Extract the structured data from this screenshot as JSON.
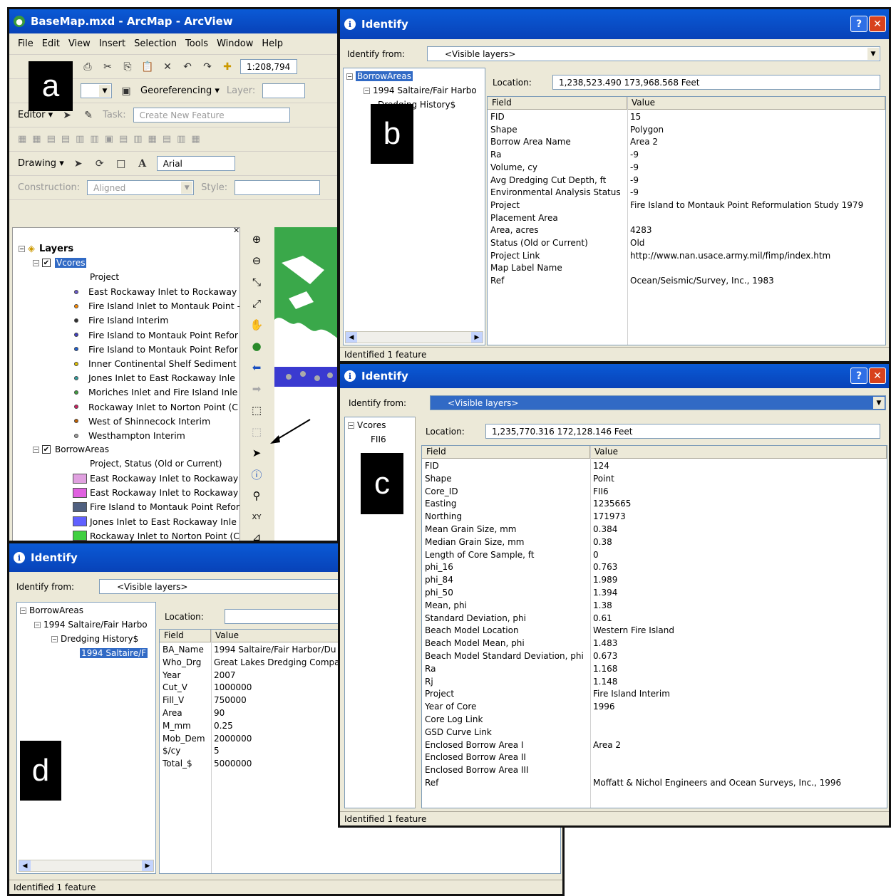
{
  "panel_tags": {
    "a": "a",
    "b": "b",
    "c": "c",
    "d": "d"
  },
  "arcmap": {
    "title": "BaseMap.mxd - ArcMap - ArcView",
    "menu": [
      "File",
      "Edit",
      "View",
      "Insert",
      "Selection",
      "Tools",
      "Window",
      "Help"
    ],
    "scale": "1:208,794",
    "georef_label": "Georeferencing ▾",
    "layer_label": "Layer:",
    "editor_label": "Editor ▾",
    "task_label": "Task:",
    "task_value": "Create New Feature",
    "drawing_label": "Drawing ▾",
    "font_value": "Arial",
    "construction_label": "Construction:",
    "construction_value": "Aligned",
    "style_label": "Style:",
    "toc": {
      "root": "Layers",
      "vcores_label": "Vcores",
      "vcores_field": "Project",
      "vcores_items": [
        {
          "label": "East Rockaway Inlet to Rockaway",
          "color": "#6a5acd"
        },
        {
          "label": "Fire Island Inlet to Montauk Point -",
          "color": "#ff8c00"
        },
        {
          "label": "Fire Island Interim",
          "color": "#303030"
        },
        {
          "label": "Fire Island to Montauk Point Refor",
          "color": "#4040c0"
        },
        {
          "label": "Fire Island to Montauk Point Refor",
          "color": "#2060d0"
        },
        {
          "label": "Inner Continental Shelf Sediment a",
          "color": "#e0c000"
        },
        {
          "label": "Jones Inlet to East Rockaway Inle",
          "color": "#30a0a0"
        },
        {
          "label": "Moriches Inlet and Fire Island Inle",
          "color": "#40a040"
        },
        {
          "label": "Rockaway Inlet to Norton Point (C",
          "color": "#d02060"
        },
        {
          "label": "West of Shinnecock Interim",
          "color": "#c06000"
        },
        {
          "label": "Westhampton Interim",
          "color": "#a0a0a0"
        }
      ],
      "borrow_label": "BorrowAreas",
      "borrow_field": "Project, Status (Old or Current)",
      "borrow_items": [
        {
          "label": "East Rockaway Inlet to Rockaway",
          "color": "#e0a0e0"
        },
        {
          "label": "East Rockaway Inlet to Rockaway",
          "color": "#e060e0"
        },
        {
          "label": "Fire Island to Montauk Point Refor",
          "color": "#506080"
        },
        {
          "label": "Jones Inlet to East Rockaway Inle",
          "color": "#6060ff"
        },
        {
          "label": "Rockaway Inlet to Norton Point (C",
          "color": "#40d040"
        }
      ]
    }
  },
  "identify_b": {
    "title": "Identify",
    "from_label": "Identify from:",
    "from_value": "<Visible layers>",
    "tree": [
      "BorrowAreas",
      "1994 Saltaire/Fair Harbo",
      "Dredging History$"
    ],
    "location_label": "Location:",
    "location_value": "1,238,523.490  173,968.568 Feet",
    "field_header": "Field",
    "value_header": "Value",
    "rows": [
      [
        "FID",
        "15"
      ],
      [
        "Shape",
        "Polygon"
      ],
      [
        "Borrow Area Name",
        "Area 2"
      ],
      [
        "Ra",
        "-9"
      ],
      [
        "Volume, cy",
        "-9"
      ],
      [
        "Avg Dredging Cut Depth, ft",
        "-9"
      ],
      [
        "Environmental Analysis Status",
        "-9"
      ],
      [
        "Project",
        "Fire Island to Montauk Point Reformulation Study 1979"
      ],
      [
        "Placement Area",
        ""
      ],
      [
        "Area, acres",
        "4283"
      ],
      [
        "Status (Old or Current)",
        "Old"
      ],
      [
        "Project Link",
        "http://www.nan.usace.army.mil/fimp/index.htm"
      ],
      [
        "Map Label Name",
        ""
      ],
      [
        "Ref",
        "Ocean/Seismic/Survey, Inc., 1983"
      ]
    ],
    "status": "Identified 1 feature"
  },
  "identify_c": {
    "title": "Identify",
    "from_label": "Identify from:",
    "from_value": "<Visible layers>",
    "tree": [
      "Vcores",
      "FII6"
    ],
    "location_label": "Location:",
    "location_value": "1,235,770.316  172,128.146 Feet",
    "field_header": "Field",
    "value_header": "Value",
    "rows": [
      [
        "FID",
        "124"
      ],
      [
        "Shape",
        "Point"
      ],
      [
        "Core_ID",
        "FII6"
      ],
      [
        "Easting",
        "1235665"
      ],
      [
        "Northing",
        "171973"
      ],
      [
        "Mean Grain Size, mm",
        "0.384"
      ],
      [
        "Median Grain Size, mm",
        "0.38"
      ],
      [
        "Length of Core Sample, ft",
        "0"
      ],
      [
        "phi_16",
        "0.763"
      ],
      [
        "phi_84",
        "1.989"
      ],
      [
        "phi_50",
        "1.394"
      ],
      [
        "Mean, phi",
        "1.38"
      ],
      [
        "Standard Deviation, phi",
        "0.61"
      ],
      [
        "Beach Model Location",
        "Western Fire Island"
      ],
      [
        "Beach Model Mean, phi",
        "1.483"
      ],
      [
        "Beach Model Standard Deviation, phi",
        "0.673"
      ],
      [
        "Ra",
        "1.168"
      ],
      [
        "Rj",
        "1.148"
      ],
      [
        "Project",
        "Fire Island Interim"
      ],
      [
        "Year of Core",
        "1996"
      ],
      [
        "Core Log Link",
        ""
      ],
      [
        "GSD Curve Link",
        ""
      ],
      [
        "Enclosed Borrow Area I",
        "Area 2"
      ],
      [
        "Enclosed Borrow Area II",
        ""
      ],
      [
        "Enclosed Borrow Area III",
        ""
      ],
      [
        "Ref",
        "Moffatt & Nichol Engineers and Ocean Surveys, Inc., 1996"
      ]
    ],
    "status": "Identified 1 feature"
  },
  "identify_d": {
    "title": "Identify",
    "from_label": "Identify from:",
    "from_value": "<Visible layers>",
    "tree": [
      "BorrowAreas",
      "1994 Saltaire/Fair Harbo",
      "Dredging History$",
      "1994 Saltaire/F"
    ],
    "location_label": "Location:",
    "field_header": "Field",
    "value_header": "Value",
    "rows": [
      [
        "BA_Name",
        "1994 Saltaire/Fair Harbor/Du"
      ],
      [
        "Who_Drg",
        "Great Lakes Dredging Compa"
      ],
      [
        "Year",
        "2007"
      ],
      [
        "Cut_V",
        "1000000"
      ],
      [
        "Fill_V",
        "750000"
      ],
      [
        "Area",
        "90"
      ],
      [
        "M_mm",
        "0.25"
      ],
      [
        "Mob_Dem",
        "2000000"
      ],
      [
        "$/cy",
        "5"
      ],
      [
        "Total_$",
        "5000000"
      ]
    ],
    "status": "Identified 1 feature"
  }
}
